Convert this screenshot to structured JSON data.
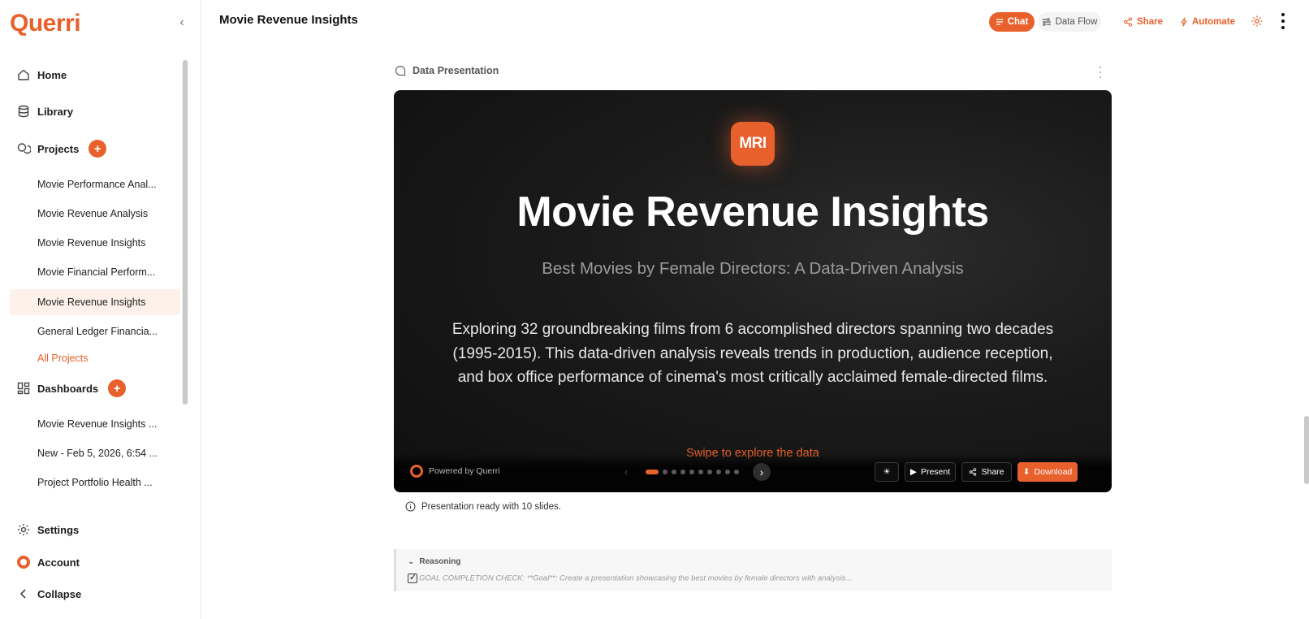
{
  "app": {
    "logo": "Querri",
    "page_title": "Movie Revenue Insights",
    "accent_color": "#e8602c"
  },
  "sidebar": {
    "home": "Home",
    "library": "Library",
    "projects_label": "Projects",
    "projects": [
      "Movie Performance Anal...",
      "Movie Revenue Analysis",
      "Movie Revenue Insights",
      "Movie Financial Perform...",
      "Movie Revenue Insights",
      "General Ledger Financia..."
    ],
    "all_projects": "All Projects",
    "dashboards_label": "Dashboards",
    "dashboards": [
      "Movie Revenue Insights ...",
      "New - Feb 5, 2026, 6:54 ...",
      "Project Portfolio Health ..."
    ],
    "settings": "Settings",
    "account": "Account",
    "collapse": "Collapse"
  },
  "topbar": {
    "chat": "Chat",
    "data_flow": "Data Flow",
    "share": "Share",
    "automate": "Automate"
  },
  "section": {
    "title": "Data Presentation"
  },
  "slide": {
    "logo_text": "MRI",
    "title": "Movie Revenue Insights",
    "subtitle": "Best Movies by Female Directors: A Data-Driven Analysis",
    "body": "Exploring 32 groundbreaking films from 6 accomplished directors spanning two decades (1995-2015). This data-driven analysis reveals trends in production, audience reception, and box office performance of cinema's most critically acclaimed female-directed films.",
    "swipe_hint": "Swipe to explore the data",
    "powered_by": "Powered by Querri",
    "slide_count": 10,
    "current_slide": 1,
    "present": "Present",
    "share": "Share",
    "download": "Download"
  },
  "status": {
    "text": "Presentation ready with 10 slides."
  },
  "reasoning": {
    "label": "Reasoning",
    "text": "GOAL COMPLETION CHECK: **Goal**: Create a presentation showcasing the best movies by female directors with analysis..."
  }
}
